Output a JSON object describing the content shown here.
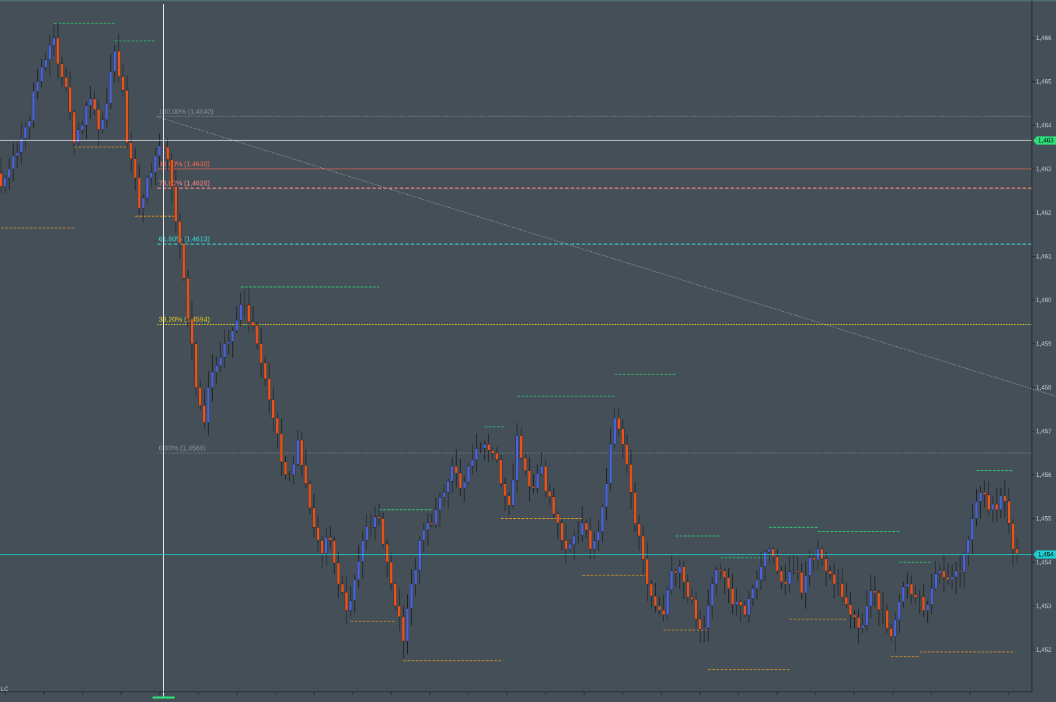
{
  "colors": {
    "background": "#454f57",
    "bull": "#4a64d8",
    "bear": "#e8541c",
    "wick": "#1a1d20",
    "swing_high": "#2ee07a",
    "swing_low": "#f0a020",
    "current_price": "#20d0d0",
    "crosshair": "#ffffff",
    "fib_100": "#8a939a",
    "fib_886": "#ff6a50",
    "fib_786": "#ff8a80",
    "fib_618": "#3ad8d8",
    "fib_382": "#e8d020",
    "fib_0": "#8a939a",
    "axis_text": "#c8cdd2"
  },
  "corner_label": "LC",
  "chart_data": {
    "type": "candlestick",
    "ylim": [
      1.4512,
      1.467
    ],
    "yticks": [
      {
        "value": 1.466,
        "label": "1,466"
      },
      {
        "value": 1.465,
        "label": "1,465"
      },
      {
        "value": 1.464,
        "label": "1,464"
      },
      {
        "value": 1.463,
        "label": "1,463"
      },
      {
        "value": 1.462,
        "label": "1,462"
      },
      {
        "value": 1.461,
        "label": "1,461"
      },
      {
        "value": 1.46,
        "label": "1,460"
      },
      {
        "value": 1.459,
        "label": "1,459"
      },
      {
        "value": 1.458,
        "label": "1,458"
      },
      {
        "value": 1.457,
        "label": "1,457"
      },
      {
        "value": 1.456,
        "label": "1,456"
      },
      {
        "value": 1.455,
        "label": "1,455"
      },
      {
        "value": 1.454,
        "label": "1,454"
      },
      {
        "value": 1.453,
        "label": "1,453"
      },
      {
        "value": 1.452,
        "label": "1,452"
      }
    ],
    "crosshair": {
      "bar": 40,
      "price": 1.46365,
      "label": "1,463"
    },
    "current_price": {
      "price": 1.45418,
      "label": "1,454"
    },
    "fibonacci": {
      "from_bar": 40,
      "to_bar": 301,
      "high": 1.4642,
      "low": 1.4566,
      "levels": [
        {
          "label": "100,00% (1,4642)",
          "price": 1.4642,
          "style": "dotted",
          "color_key": "fib_100"
        },
        {
          "label": "88,60% (1,4630)",
          "price": 1.463,
          "style": "solid",
          "color_key": "fib_886"
        },
        {
          "label": "78,60% (1,4626)",
          "price": 1.46256,
          "style": "dashed",
          "color_key": "fib_786"
        },
        {
          "label": "61,80% (1,4613)",
          "price": 1.46128,
          "style": "dashed",
          "color_key": "fib_618"
        },
        {
          "label": "38,20% (1,4594)",
          "price": 1.45944,
          "style": "dotted",
          "color_key": "fib_382"
        },
        {
          "label": "0,00% (1,4566)",
          "price": 1.4565,
          "style": "dotted",
          "color_key": "fib_0"
        }
      ]
    },
    "swing_highs": [
      {
        "price": 1.46633,
        "from_bar": 13,
        "to_bar": 28
      },
      {
        "price": 1.46593,
        "from_bar": 28,
        "to_bar": 38
      },
      {
        "price": 1.4603,
        "from_bar": 59,
        "to_bar": 93
      },
      {
        "price": 1.4552,
        "from_bar": 93,
        "to_bar": 106
      },
      {
        "price": 1.4571,
        "from_bar": 119,
        "to_bar": 124
      },
      {
        "price": 1.4578,
        "from_bar": 127,
        "to_bar": 151
      },
      {
        "price": 1.4583,
        "from_bar": 151,
        "to_bar": 166
      },
      {
        "price": 1.4546,
        "from_bar": 166,
        "to_bar": 177
      },
      {
        "price": 1.4541,
        "from_bar": 177,
        "to_bar": 189
      },
      {
        "price": 1.4548,
        "from_bar": 189,
        "to_bar": 201
      },
      {
        "price": 1.4547,
        "from_bar": 201,
        "to_bar": 221
      },
      {
        "price": 1.454,
        "from_bar": 221,
        "to_bar": 229
      },
      {
        "price": 1.4561,
        "from_bar": 240,
        "to_bar": 249
      }
    ],
    "swing_lows": [
      {
        "price": 1.46165,
        "from_bar": 0,
        "to_bar": 18
      },
      {
        "price": 1.4635,
        "from_bar": 18,
        "to_bar": 31
      },
      {
        "price": 1.46192,
        "from_bar": 33,
        "to_bar": 43
      },
      {
        "price": 1.45265,
        "from_bar": 86,
        "to_bar": 97
      },
      {
        "price": 1.45175,
        "from_bar": 99,
        "to_bar": 123
      },
      {
        "price": 1.455,
        "from_bar": 123,
        "to_bar": 143
      },
      {
        "price": 1.4537,
        "from_bar": 143,
        "to_bar": 159
      },
      {
        "price": 1.45245,
        "from_bar": 163,
        "to_bar": 174
      },
      {
        "price": 1.45155,
        "from_bar": 174,
        "to_bar": 194
      },
      {
        "price": 1.4527,
        "from_bar": 194,
        "to_bar": 208
      },
      {
        "price": 1.45185,
        "from_bar": 219,
        "to_bar": 226
      },
      {
        "price": 1.45195,
        "from_bar": 226,
        "to_bar": 249
      }
    ],
    "anchors": [
      [
        0,
        1.4626
      ],
      [
        2,
        1.463
      ],
      [
        5,
        1.4637
      ],
      [
        7,
        1.4641
      ],
      [
        9,
        1.465
      ],
      [
        11,
        1.4655
      ],
      [
        13,
        1.466
      ],
      [
        15,
        1.4651
      ],
      [
        17,
        1.4643
      ],
      [
        18,
        1.4636
      ],
      [
        20,
        1.464
      ],
      [
        22,
        1.4646
      ],
      [
        24,
        1.4639
      ],
      [
        26,
        1.4645
      ],
      [
        28,
        1.4657
      ],
      [
        30,
        1.4648
      ],
      [
        31,
        1.4636
      ],
      [
        33,
        1.4628
      ],
      [
        34,
        1.4621
      ],
      [
        36,
        1.4628
      ],
      [
        38,
        1.4633
      ],
      [
        40,
        1.4635
      ],
      [
        42,
        1.4626
      ],
      [
        43,
        1.4618
      ],
      [
        45,
        1.4605
      ],
      [
        47,
        1.459
      ],
      [
        48,
        1.458
      ],
      [
        50,
        1.4572
      ],
      [
        51,
        1.458
      ],
      [
        53,
        1.4585
      ],
      [
        55,
        1.459
      ],
      [
        57,
        1.4593
      ],
      [
        59,
        1.4599
      ],
      [
        61,
        1.4595
      ],
      [
        63,
        1.459
      ],
      [
        65,
        1.4582
      ],
      [
        67,
        1.4573
      ],
      [
        69,
        1.4563
      ],
      [
        71,
        1.456
      ],
      [
        73,
        1.4568
      ],
      [
        75,
        1.4558
      ],
      [
        77,
        1.4548
      ],
      [
        79,
        1.4542
      ],
      [
        81,
        1.4545
      ],
      [
        83,
        1.4535
      ],
      [
        85,
        1.4529
      ],
      [
        87,
        1.4536
      ],
      [
        89,
        1.4545
      ],
      [
        91,
        1.4548
      ],
      [
        93,
        1.455
      ],
      [
        95,
        1.454
      ],
      [
        97,
        1.453
      ],
      [
        99,
        1.4522
      ],
      [
        101,
        1.4535
      ],
      [
        103,
        1.4545
      ],
      [
        105,
        1.4549
      ],
      [
        107,
        1.4552
      ],
      [
        109,
        1.4556
      ],
      [
        111,
        1.4562
      ],
      [
        113,
        1.4557
      ],
      [
        115,
        1.4562
      ],
      [
        117,
        1.4566
      ],
      [
        119,
        1.4567
      ],
      [
        121,
        1.4565
      ],
      [
        123,
        1.4558
      ],
      [
        125,
        1.4553
      ],
      [
        127,
        1.4569
      ],
      [
        129,
        1.4561
      ],
      [
        131,
        1.4557
      ],
      [
        133,
        1.4562
      ],
      [
        135,
        1.4555
      ],
      [
        137,
        1.4549
      ],
      [
        139,
        1.4543
      ],
      [
        141,
        1.4546
      ],
      [
        143,
        1.4549
      ],
      [
        145,
        1.4543
      ],
      [
        147,
        1.4547
      ],
      [
        149,
        1.4558
      ],
      [
        151,
        1.4573
      ],
      [
        153,
        1.4567
      ],
      [
        155,
        1.4556
      ],
      [
        157,
        1.4546
      ],
      [
        159,
        1.4535
      ],
      [
        161,
        1.453
      ],
      [
        163,
        1.4528
      ],
      [
        165,
        1.4538
      ],
      [
        167,
        1.4539
      ],
      [
        169,
        1.4532
      ],
      [
        171,
        1.4527
      ],
      [
        173,
        1.4525
      ],
      [
        175,
        1.4535
      ],
      [
        177,
        1.4538
      ],
      [
        179,
        1.4534
      ],
      [
        181,
        1.4531
      ],
      [
        183,
        1.4528
      ],
      [
        185,
        1.4534
      ],
      [
        187,
        1.4539
      ],
      [
        189,
        1.4543
      ],
      [
        191,
        1.4538
      ],
      [
        193,
        1.4535
      ],
      [
        195,
        1.4538
      ],
      [
        197,
        1.4533
      ],
      [
        199,
        1.4541
      ],
      [
        201,
        1.4543
      ],
      [
        203,
        1.4538
      ],
      [
        205,
        1.4535
      ],
      [
        207,
        1.4532
      ],
      [
        209,
        1.4528
      ],
      [
        211,
        1.4525
      ],
      [
        213,
        1.453
      ],
      [
        215,
        1.4533
      ],
      [
        217,
        1.4529
      ],
      [
        219,
        1.4523
      ],
      [
        221,
        1.4531
      ],
      [
        223,
        1.4535
      ],
      [
        225,
        1.4532
      ],
      [
        227,
        1.4529
      ],
      [
        229,
        1.4534
      ],
      [
        231,
        1.4538
      ],
      [
        233,
        1.4536
      ],
      [
        235,
        1.4538
      ],
      [
        237,
        1.4542
      ],
      [
        239,
        1.455
      ],
      [
        241,
        1.4556
      ],
      [
        243,
        1.4552
      ],
      [
        245,
        1.4552
      ],
      [
        247,
        1.4554
      ],
      [
        249,
        1.4543
      ],
      [
        250,
        1.4542
      ]
    ]
  }
}
